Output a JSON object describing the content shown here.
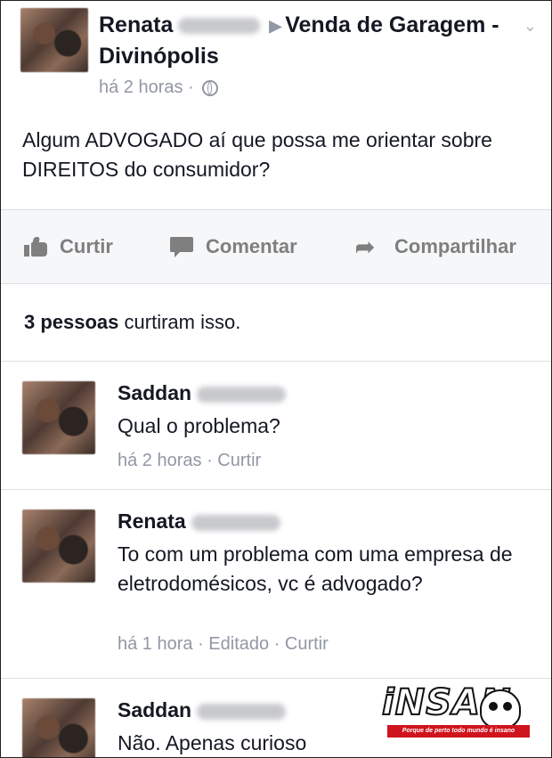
{
  "post": {
    "author": "Renata",
    "group": "Venda de Garagem - Divinópolis",
    "time": "há 2 horas",
    "separator": "·",
    "text": "Algum ADVOGADO aí que possa me orientar sobre DIREITOS do consumidor?"
  },
  "actions": {
    "like": "Curtir",
    "comment": "Comentar",
    "share": "Compartilhar"
  },
  "likes": {
    "count": "3 pessoas",
    "suffix": "curtiram isso."
  },
  "comments": [
    {
      "name": "Saddan",
      "text": "Qual o problema?",
      "time": "há 2 horas",
      "actions": "· Curtir"
    },
    {
      "name": "Renata",
      "text": "To com um problema com uma empresa de eletrodomésicos, vc é advogado?",
      "time": "há 1 hora",
      "actions": "· Editado · Curtir"
    },
    {
      "name": "Saddan",
      "text": "Não. Apenas curioso",
      "time": "",
      "actions": ""
    }
  ],
  "watermark": {
    "word": "iNSAN",
    "tagline": "Porque de perto todo mundo é insano"
  },
  "icons": [
    "like-icon",
    "comment-icon",
    "share-icon",
    "globe-icon",
    "chevron-down-icon"
  ]
}
